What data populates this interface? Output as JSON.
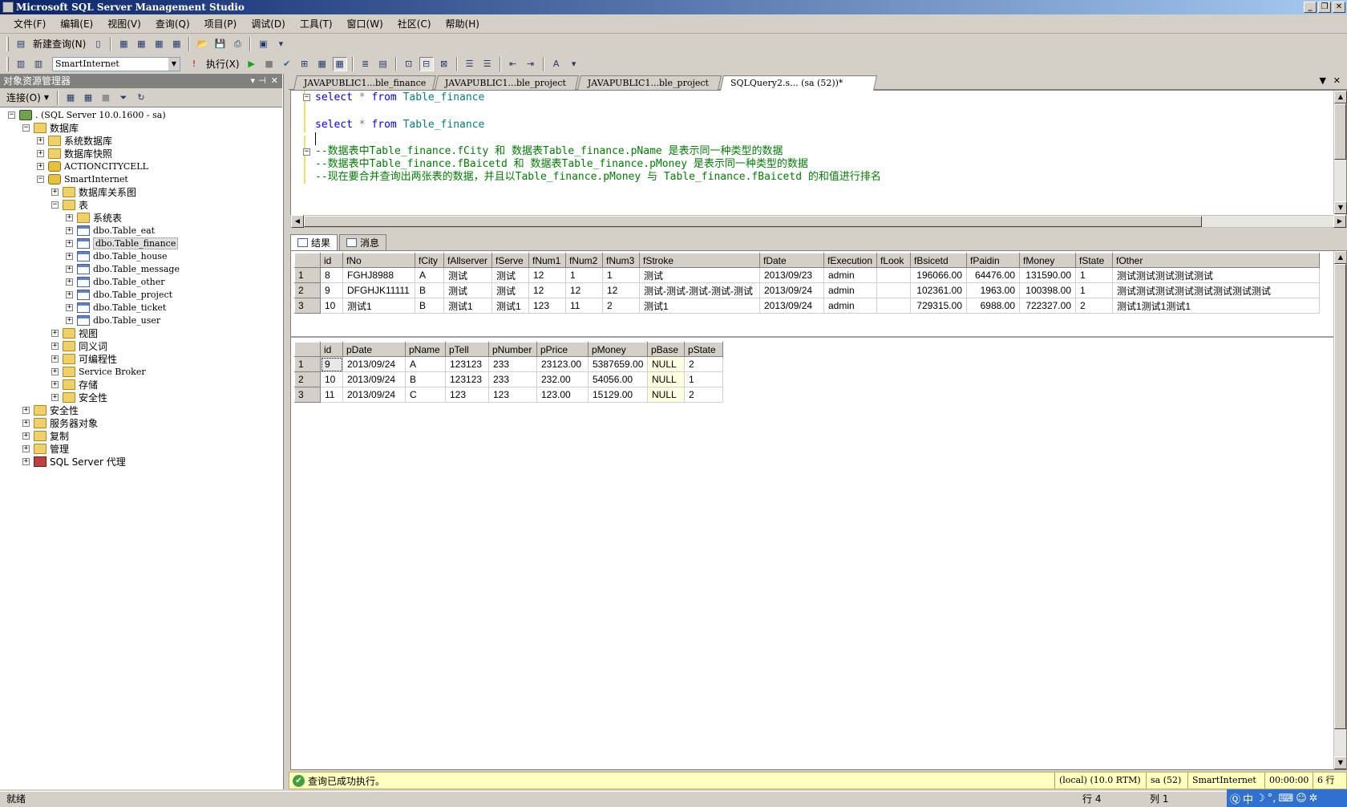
{
  "window": {
    "title": "Microsoft SQL Server Management Studio"
  },
  "menu": [
    "文件(F)",
    "编辑(E)",
    "视图(V)",
    "查询(Q)",
    "项目(P)",
    "调试(D)",
    "工具(T)",
    "窗口(W)",
    "社区(C)",
    "帮助(H)"
  ],
  "toolbar1": {
    "new_query": "新建查询(N)"
  },
  "toolbar2": {
    "database": "SmartInternet",
    "execute": "执行(X)"
  },
  "object_explorer": {
    "title": "对象资源管理器",
    "connect": "连接(O)",
    "tree": [
      {
        "label": ". (SQL Server 10.0.1600 - sa)",
        "level": 0,
        "expanded": true,
        "icon": "server-icon"
      },
      {
        "label": "数据库",
        "level": 1,
        "expanded": true,
        "icon": "folder-icon"
      },
      {
        "label": "系统数据库",
        "level": 2,
        "expanded": false,
        "icon": "folder-icon"
      },
      {
        "label": "数据库快照",
        "level": 2,
        "expanded": false,
        "icon": "folder-icon"
      },
      {
        "label": "ACTIONCITYCELL",
        "level": 2,
        "expanded": false,
        "icon": "database-icon"
      },
      {
        "label": "SmartInternet",
        "level": 2,
        "expanded": true,
        "icon": "database-icon"
      },
      {
        "label": "数据库关系图",
        "level": 3,
        "expanded": false,
        "icon": "folder-icon"
      },
      {
        "label": "表",
        "level": 3,
        "expanded": true,
        "icon": "folder-icon"
      },
      {
        "label": "系统表",
        "level": 4,
        "expanded": false,
        "icon": "folder-icon"
      },
      {
        "label": "dbo.Table_eat",
        "level": 4,
        "expanded": false,
        "icon": "table-icon"
      },
      {
        "label": "dbo.Table_finance",
        "level": 4,
        "expanded": false,
        "icon": "table-icon",
        "selected": true
      },
      {
        "label": "dbo.Table_house",
        "level": 4,
        "expanded": false,
        "icon": "table-icon"
      },
      {
        "label": "dbo.Table_message",
        "level": 4,
        "expanded": false,
        "icon": "table-icon"
      },
      {
        "label": "dbo.Table_other",
        "level": 4,
        "expanded": false,
        "icon": "table-icon"
      },
      {
        "label": "dbo.Table_project",
        "level": 4,
        "expanded": false,
        "icon": "table-icon"
      },
      {
        "label": "dbo.Table_ticket",
        "level": 4,
        "expanded": false,
        "icon": "table-icon"
      },
      {
        "label": "dbo.Table_user",
        "level": 4,
        "expanded": false,
        "icon": "table-icon"
      },
      {
        "label": "视图",
        "level": 3,
        "expanded": false,
        "icon": "folder-icon"
      },
      {
        "label": "同义词",
        "level": 3,
        "expanded": false,
        "icon": "folder-icon"
      },
      {
        "label": "可编程性",
        "level": 3,
        "expanded": false,
        "icon": "folder-icon"
      },
      {
        "label": "Service Broker",
        "level": 3,
        "expanded": false,
        "icon": "folder-icon"
      },
      {
        "label": "存储",
        "level": 3,
        "expanded": false,
        "icon": "folder-icon"
      },
      {
        "label": "安全性",
        "level": 3,
        "expanded": false,
        "icon": "folder-icon"
      },
      {
        "label": "安全性",
        "level": 1,
        "expanded": false,
        "icon": "folder-icon"
      },
      {
        "label": "服务器对象",
        "level": 1,
        "expanded": false,
        "icon": "folder-icon"
      },
      {
        "label": "复制",
        "level": 1,
        "expanded": false,
        "icon": "folder-icon"
      },
      {
        "label": "管理",
        "level": 1,
        "expanded": false,
        "icon": "folder-icon"
      },
      {
        "label": "SQL Server 代理",
        "level": 1,
        "expanded": false,
        "icon": "agent-icon"
      }
    ]
  },
  "doc_tabs": [
    {
      "label": "JAVAPUBLIC1...ble_finance",
      "active": false
    },
    {
      "label": "JAVAPUBLIC1...ble_project",
      "active": false
    },
    {
      "label": "JAVAPUBLIC1...ble_project",
      "active": false
    },
    {
      "label": "SQLQuery2.s... (sa (52))*",
      "active": true
    }
  ],
  "editor": {
    "line1": {
      "kw": "select",
      "op": "*",
      "kw2": "from",
      "id": "Table_finance"
    },
    "line2": {
      "kw": "select",
      "op": "*",
      "kw2": "from",
      "id": "Table_finance"
    },
    "comments": [
      "--数据表中Table_finance.fCity 和 数据表Table_finance.pName 是表示同一种类型的数据",
      "--数据表中Table_finance.fBaicetd 和 数据表Table_finance.pMoney 是表示同一种类型的数据",
      "--现在要合并查询出两张表的数据，并且以Table_finance.pMoney 与 Table_finance.fBaicetd 的和值进行排名"
    ]
  },
  "result_tabs": {
    "results": "结果",
    "messages": "消息"
  },
  "grid1": {
    "columns": [
      "",
      "id",
      "fNo",
      "fCity",
      "fAllserver",
      "fServe",
      "fNum1",
      "fNum2",
      "fNum3",
      "fStroke",
      "fDate",
      "fExecution",
      "fLook",
      "fBsicetd",
      "fPaidin",
      "fMoney",
      "fState",
      "fOther"
    ],
    "rows": [
      [
        "1",
        "8",
        "FGHJ8988",
        "A",
        "测试",
        "测试",
        "12",
        "1",
        "1",
        "测试",
        "2013/09/23",
        "admin",
        "",
        "196066.00",
        "64476.00",
        "131590.00",
        "1",
        "测试测试测试测试测试"
      ],
      [
        "2",
        "9",
        "DFGHJK11111",
        "B",
        "测试",
        "测试",
        "12",
        "12",
        "12",
        "测试-测试-测试-测试-测试",
        "2013/09/24",
        "admin",
        "",
        "102361.00",
        "1963.00",
        "100398.00",
        "1",
        "测试测试测试测试测试测试测试测试"
      ],
      [
        "3",
        "10",
        "测试1",
        "B",
        "测试1",
        "测试1",
        "123",
        "11",
        "2",
        "测试1",
        "2013/09/24",
        "admin",
        "",
        "729315.00",
        "6988.00",
        "722327.00",
        "2",
        "测试1测试1测试1"
      ]
    ]
  },
  "grid2": {
    "columns": [
      "",
      "id",
      "pDate",
      "pName",
      "pTell",
      "pNumber",
      "pPrice",
      "pMoney",
      "pBase",
      "pState"
    ],
    "rows": [
      [
        "1",
        "9",
        "2013/09/24",
        "A",
        "123123",
        "233",
        "23123.00",
        "5387659.00",
        "NULL",
        "2"
      ],
      [
        "2",
        "10",
        "2013/09/24",
        "B",
        "123123",
        "233",
        "232.00",
        "54056.00",
        "NULL",
        "1"
      ],
      [
        "3",
        "11",
        "2013/09/24",
        "C",
        "123",
        "123",
        "123.00",
        "15129.00",
        "NULL",
        "2"
      ]
    ]
  },
  "query_status": {
    "message": "查询已成功执行。",
    "server": "(local) (10.0 RTM)",
    "user": "sa (52)",
    "database": "SmartInternet",
    "elapsed": "00:00:00",
    "rows": "6 行"
  },
  "statusbar": {
    "ready": "就绪",
    "line": "行 4",
    "col": "列 1"
  },
  "ime": {
    "mode": "中"
  }
}
